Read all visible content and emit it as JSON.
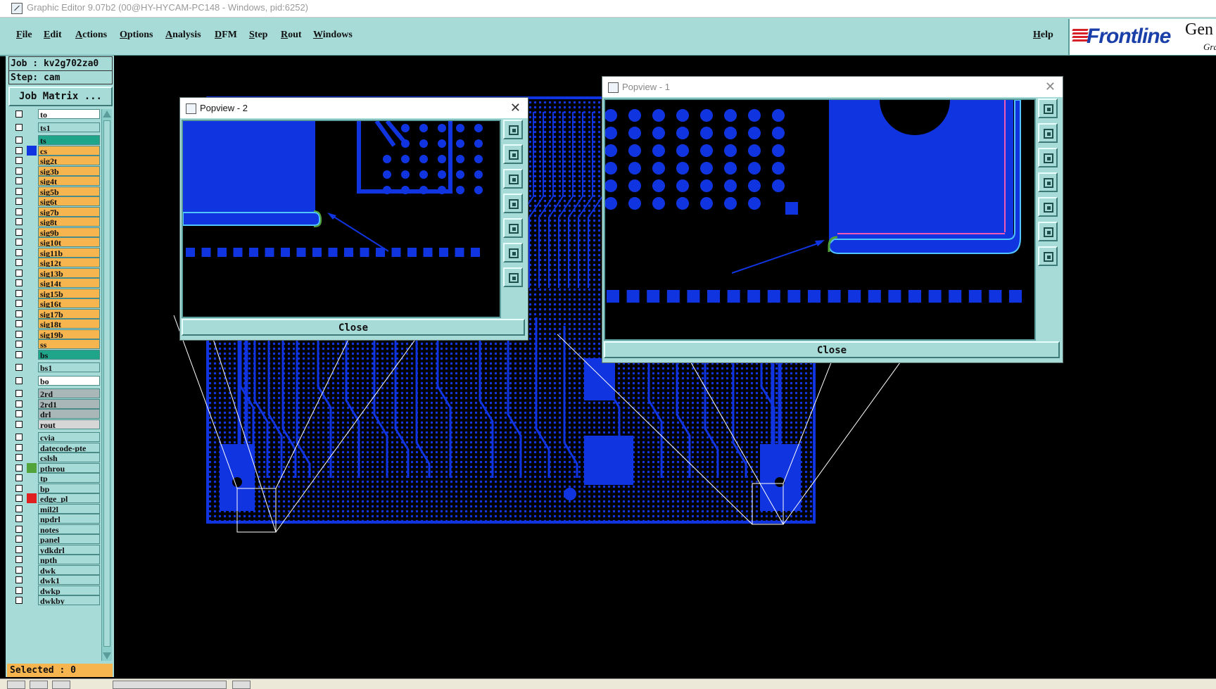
{
  "window": {
    "title": "Graphic Editor 9.07b2 (00@HY-HYCAM-PC148 - Windows, pid:6252)"
  },
  "menu": {
    "items": [
      "File",
      "Edit",
      "Actions",
      "Options",
      "Analysis",
      "DFM",
      "Step",
      "Rout",
      "Windows"
    ],
    "help": "Help"
  },
  "logo": {
    "brand": "Frontline",
    "product": "Gen",
    "product_sub": "Gra"
  },
  "job": {
    "job_line": "Job : kv2g702za0",
    "step_line": "Step: cam",
    "matrix_button": "Job Matrix ..."
  },
  "layers": [
    {
      "name": "to",
      "color": "#ffffff",
      "swatch": ""
    },
    {
      "name": "ts1",
      "color": "#a6dbd8",
      "swatch": ""
    },
    {
      "name": "ts",
      "color": "#1fa58a",
      "swatch": ""
    },
    {
      "name": "cs",
      "color": "#f7b54f",
      "swatch": "#1035e0"
    },
    {
      "name": "sig2t",
      "color": "#f7b54f",
      "swatch": ""
    },
    {
      "name": "sig3b",
      "color": "#f7b54f",
      "swatch": ""
    },
    {
      "name": "sig4t",
      "color": "#f7b54f",
      "swatch": ""
    },
    {
      "name": "sig5b",
      "color": "#f7b54f",
      "swatch": ""
    },
    {
      "name": "sig6t",
      "color": "#f7b54f",
      "swatch": ""
    },
    {
      "name": "sig7b",
      "color": "#f7b54f",
      "swatch": ""
    },
    {
      "name": "sig8t",
      "color": "#f7b54f",
      "swatch": ""
    },
    {
      "name": "sig9b",
      "color": "#f7b54f",
      "swatch": ""
    },
    {
      "name": "sig10t",
      "color": "#f7b54f",
      "swatch": ""
    },
    {
      "name": "sig11b",
      "color": "#f7b54f",
      "swatch": ""
    },
    {
      "name": "sig12t",
      "color": "#f7b54f",
      "swatch": ""
    },
    {
      "name": "sig13b",
      "color": "#f7b54f",
      "swatch": ""
    },
    {
      "name": "sig14t",
      "color": "#f7b54f",
      "swatch": ""
    },
    {
      "name": "sig15b",
      "color": "#f7b54f",
      "swatch": ""
    },
    {
      "name": "sig16t",
      "color": "#f7b54f",
      "swatch": ""
    },
    {
      "name": "sig17b",
      "color": "#f7b54f",
      "swatch": ""
    },
    {
      "name": "sig18t",
      "color": "#f7b54f",
      "swatch": ""
    },
    {
      "name": "sig19b",
      "color": "#f7b54f",
      "swatch": ""
    },
    {
      "name": "ss",
      "color": "#f7b54f",
      "swatch": ""
    },
    {
      "name": "bs",
      "color": "#1fa58a",
      "swatch": ""
    },
    {
      "name": "bs1",
      "color": "#a6dbd8",
      "swatch": ""
    },
    {
      "name": "bo",
      "color": "#ffffff",
      "swatch": ""
    },
    {
      "name": "2rd",
      "color": "#a9b7b9",
      "swatch": ""
    },
    {
      "name": "2rd1",
      "color": "#a9b7b9",
      "swatch": ""
    },
    {
      "name": "drl",
      "color": "#a9b7b9",
      "swatch": ""
    },
    {
      "name": "rout",
      "color": "#d6d6d6",
      "swatch": ""
    },
    {
      "name": "cvia",
      "color": "#a6dbd8",
      "swatch": ""
    },
    {
      "name": "datecode-pte",
      "color": "#a6dbd8",
      "swatch": ""
    },
    {
      "name": "cslsh",
      "color": "#a6dbd8",
      "swatch": ""
    },
    {
      "name": "pthrou",
      "color": "#a6dbd8",
      "swatch": "#52a43a"
    },
    {
      "name": "tp",
      "color": "#a6dbd8",
      "swatch": ""
    },
    {
      "name": "bp",
      "color": "#a6dbd8",
      "swatch": ""
    },
    {
      "name": "edge_pl",
      "color": "#a6dbd8",
      "swatch": "#e02020"
    },
    {
      "name": "mil2l",
      "color": "#a6dbd8",
      "swatch": ""
    },
    {
      "name": "npdrl",
      "color": "#a6dbd8",
      "swatch": ""
    },
    {
      "name": "notes",
      "color": "#a6dbd8",
      "swatch": ""
    },
    {
      "name": "panel",
      "color": "#a6dbd8",
      "swatch": ""
    },
    {
      "name": "ydkdrl",
      "color": "#a6dbd8",
      "swatch": ""
    },
    {
      "name": "npth",
      "color": "#a6dbd8",
      "swatch": ""
    },
    {
      "name": "dwk",
      "color": "#a6dbd8",
      "swatch": ""
    },
    {
      "name": "dwk1",
      "color": "#a6dbd8",
      "swatch": ""
    },
    {
      "name": "dwkp",
      "color": "#a6dbd8",
      "swatch": ""
    },
    {
      "name": "dwkby",
      "color": "#a6dbd8",
      "swatch": ""
    }
  ],
  "status": {
    "selected": "Selected : 0"
  },
  "popview2": {
    "title": "Popview - 2",
    "close": "Close"
  },
  "popview1": {
    "title": "Popview - 1",
    "close": "Close"
  },
  "colors": {
    "board": "#1035e0",
    "panel": "#a6dbd8",
    "highlight": "#f7b54f",
    "teal": "#1fa58a"
  }
}
